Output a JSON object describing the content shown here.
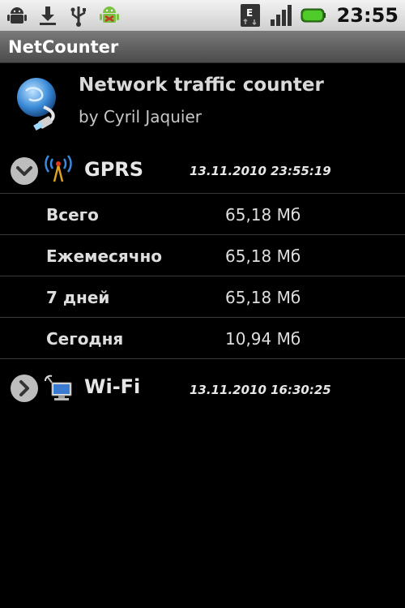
{
  "status_bar": {
    "left_icons": [
      "android-debug-icon",
      "download-icon",
      "usb-icon",
      "android-bug-icon"
    ],
    "right_icons": [
      "edge-data-icon",
      "signal-icon",
      "battery-icon"
    ],
    "time": "23:55"
  },
  "title_bar": {
    "title": "NetCounter"
  },
  "header": {
    "app_name": "Network traffic counter",
    "author": "by Cyril Jaquier"
  },
  "gprs": {
    "name": "GPRS",
    "timestamp": "13.11.2010 23:55:19",
    "expanded": true,
    "rows": [
      {
        "label": "Всего",
        "value": "65,18 Мб"
      },
      {
        "label": "Ежемесячно",
        "value": "65,18 Мб"
      },
      {
        "label": "7 дней",
        "value": "65,18 Мб"
      },
      {
        "label": "Сегодня",
        "value": "10,94 Мб"
      }
    ]
  },
  "wifi": {
    "name": "Wi-Fi",
    "timestamp": "13.11.2010 16:30:25",
    "expanded": false
  },
  "colors": {
    "background": "#000000",
    "status_bar": "#dcdcdc",
    "title_bar": "#5e5e5e",
    "divider": "#3a3a3a",
    "battery": "#3cb520"
  }
}
